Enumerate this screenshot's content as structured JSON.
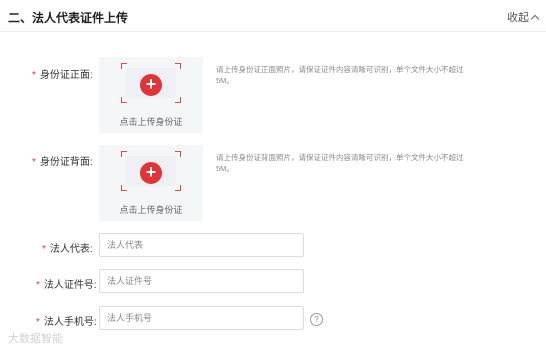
{
  "section": {
    "title": "二、法人代表证件上传",
    "collapse_label": "收起"
  },
  "id_front": {
    "label": "身份证正面:",
    "upload_caption": "点击上传身份证",
    "hint": "请上传身份证正面照片，请保证证件内容清晰可识别，单个文件大小不超过5M。"
  },
  "id_back": {
    "label": "身份证背面:",
    "upload_caption": "点击上传身份证",
    "hint": "请上传身份证背面照片，请保证证件内容清晰可识别，单个文件大小不超过5M。"
  },
  "legal_rep": {
    "label": "法人代表:",
    "placeholder": "法人代表"
  },
  "legal_id": {
    "label": "法人证件号:",
    "placeholder": "法人证件号"
  },
  "legal_phone": {
    "label": "法人手机号:",
    "placeholder": "法人手机号"
  },
  "required_mark": "*",
  "help_icon": "?",
  "watermark": "大数据智能"
}
